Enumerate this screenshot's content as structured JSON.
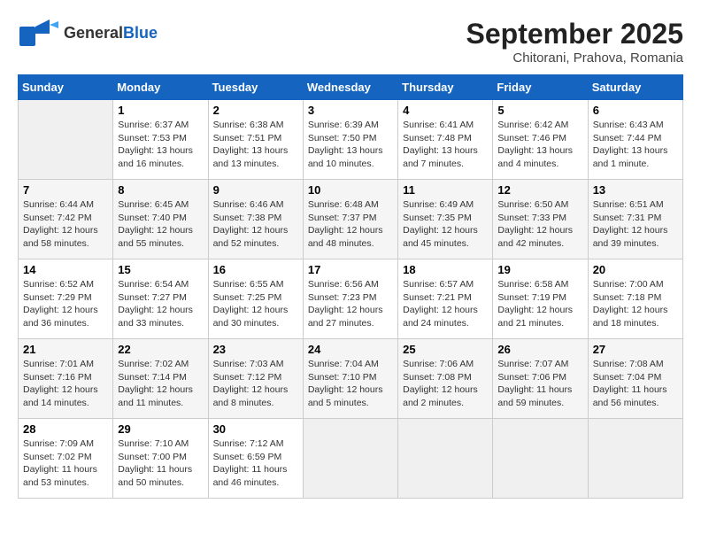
{
  "header": {
    "logo_general": "General",
    "logo_blue": "Blue",
    "month": "September 2025",
    "location": "Chitorani, Prahova, Romania"
  },
  "days_of_week": [
    "Sunday",
    "Monday",
    "Tuesday",
    "Wednesday",
    "Thursday",
    "Friday",
    "Saturday"
  ],
  "weeks": [
    [
      {
        "day": "",
        "sunrise": "",
        "sunset": "",
        "daylight": ""
      },
      {
        "day": "1",
        "sunrise": "Sunrise: 6:37 AM",
        "sunset": "Sunset: 7:53 PM",
        "daylight": "Daylight: 13 hours and 16 minutes."
      },
      {
        "day": "2",
        "sunrise": "Sunrise: 6:38 AM",
        "sunset": "Sunset: 7:51 PM",
        "daylight": "Daylight: 13 hours and 13 minutes."
      },
      {
        "day": "3",
        "sunrise": "Sunrise: 6:39 AM",
        "sunset": "Sunset: 7:50 PM",
        "daylight": "Daylight: 13 hours and 10 minutes."
      },
      {
        "day": "4",
        "sunrise": "Sunrise: 6:41 AM",
        "sunset": "Sunset: 7:48 PM",
        "daylight": "Daylight: 13 hours and 7 minutes."
      },
      {
        "day": "5",
        "sunrise": "Sunrise: 6:42 AM",
        "sunset": "Sunset: 7:46 PM",
        "daylight": "Daylight: 13 hours and 4 minutes."
      },
      {
        "day": "6",
        "sunrise": "Sunrise: 6:43 AM",
        "sunset": "Sunset: 7:44 PM",
        "daylight": "Daylight: 13 hours and 1 minute."
      }
    ],
    [
      {
        "day": "7",
        "sunrise": "Sunrise: 6:44 AM",
        "sunset": "Sunset: 7:42 PM",
        "daylight": "Daylight: 12 hours and 58 minutes."
      },
      {
        "day": "8",
        "sunrise": "Sunrise: 6:45 AM",
        "sunset": "Sunset: 7:40 PM",
        "daylight": "Daylight: 12 hours and 55 minutes."
      },
      {
        "day": "9",
        "sunrise": "Sunrise: 6:46 AM",
        "sunset": "Sunset: 7:38 PM",
        "daylight": "Daylight: 12 hours and 52 minutes."
      },
      {
        "day": "10",
        "sunrise": "Sunrise: 6:48 AM",
        "sunset": "Sunset: 7:37 PM",
        "daylight": "Daylight: 12 hours and 48 minutes."
      },
      {
        "day": "11",
        "sunrise": "Sunrise: 6:49 AM",
        "sunset": "Sunset: 7:35 PM",
        "daylight": "Daylight: 12 hours and 45 minutes."
      },
      {
        "day": "12",
        "sunrise": "Sunrise: 6:50 AM",
        "sunset": "Sunset: 7:33 PM",
        "daylight": "Daylight: 12 hours and 42 minutes."
      },
      {
        "day": "13",
        "sunrise": "Sunrise: 6:51 AM",
        "sunset": "Sunset: 7:31 PM",
        "daylight": "Daylight: 12 hours and 39 minutes."
      }
    ],
    [
      {
        "day": "14",
        "sunrise": "Sunrise: 6:52 AM",
        "sunset": "Sunset: 7:29 PM",
        "daylight": "Daylight: 12 hours and 36 minutes."
      },
      {
        "day": "15",
        "sunrise": "Sunrise: 6:54 AM",
        "sunset": "Sunset: 7:27 PM",
        "daylight": "Daylight: 12 hours and 33 minutes."
      },
      {
        "day": "16",
        "sunrise": "Sunrise: 6:55 AM",
        "sunset": "Sunset: 7:25 PM",
        "daylight": "Daylight: 12 hours and 30 minutes."
      },
      {
        "day": "17",
        "sunrise": "Sunrise: 6:56 AM",
        "sunset": "Sunset: 7:23 PM",
        "daylight": "Daylight: 12 hours and 27 minutes."
      },
      {
        "day": "18",
        "sunrise": "Sunrise: 6:57 AM",
        "sunset": "Sunset: 7:21 PM",
        "daylight": "Daylight: 12 hours and 24 minutes."
      },
      {
        "day": "19",
        "sunrise": "Sunrise: 6:58 AM",
        "sunset": "Sunset: 7:19 PM",
        "daylight": "Daylight: 12 hours and 21 minutes."
      },
      {
        "day": "20",
        "sunrise": "Sunrise: 7:00 AM",
        "sunset": "Sunset: 7:18 PM",
        "daylight": "Daylight: 12 hours and 18 minutes."
      }
    ],
    [
      {
        "day": "21",
        "sunrise": "Sunrise: 7:01 AM",
        "sunset": "Sunset: 7:16 PM",
        "daylight": "Daylight: 12 hours and 14 minutes."
      },
      {
        "day": "22",
        "sunrise": "Sunrise: 7:02 AM",
        "sunset": "Sunset: 7:14 PM",
        "daylight": "Daylight: 12 hours and 11 minutes."
      },
      {
        "day": "23",
        "sunrise": "Sunrise: 7:03 AM",
        "sunset": "Sunset: 7:12 PM",
        "daylight": "Daylight: 12 hours and 8 minutes."
      },
      {
        "day": "24",
        "sunrise": "Sunrise: 7:04 AM",
        "sunset": "Sunset: 7:10 PM",
        "daylight": "Daylight: 12 hours and 5 minutes."
      },
      {
        "day": "25",
        "sunrise": "Sunrise: 7:06 AM",
        "sunset": "Sunset: 7:08 PM",
        "daylight": "Daylight: 12 hours and 2 minutes."
      },
      {
        "day": "26",
        "sunrise": "Sunrise: 7:07 AM",
        "sunset": "Sunset: 7:06 PM",
        "daylight": "Daylight: 11 hours and 59 minutes."
      },
      {
        "day": "27",
        "sunrise": "Sunrise: 7:08 AM",
        "sunset": "Sunset: 7:04 PM",
        "daylight": "Daylight: 11 hours and 56 minutes."
      }
    ],
    [
      {
        "day": "28",
        "sunrise": "Sunrise: 7:09 AM",
        "sunset": "Sunset: 7:02 PM",
        "daylight": "Daylight: 11 hours and 53 minutes."
      },
      {
        "day": "29",
        "sunrise": "Sunrise: 7:10 AM",
        "sunset": "Sunset: 7:00 PM",
        "daylight": "Daylight: 11 hours and 50 minutes."
      },
      {
        "day": "30",
        "sunrise": "Sunrise: 7:12 AM",
        "sunset": "Sunset: 6:59 PM",
        "daylight": "Daylight: 11 hours and 46 minutes."
      },
      {
        "day": "",
        "sunrise": "",
        "sunset": "",
        "daylight": ""
      },
      {
        "day": "",
        "sunrise": "",
        "sunset": "",
        "daylight": ""
      },
      {
        "day": "",
        "sunrise": "",
        "sunset": "",
        "daylight": ""
      },
      {
        "day": "",
        "sunrise": "",
        "sunset": "",
        "daylight": ""
      }
    ]
  ]
}
